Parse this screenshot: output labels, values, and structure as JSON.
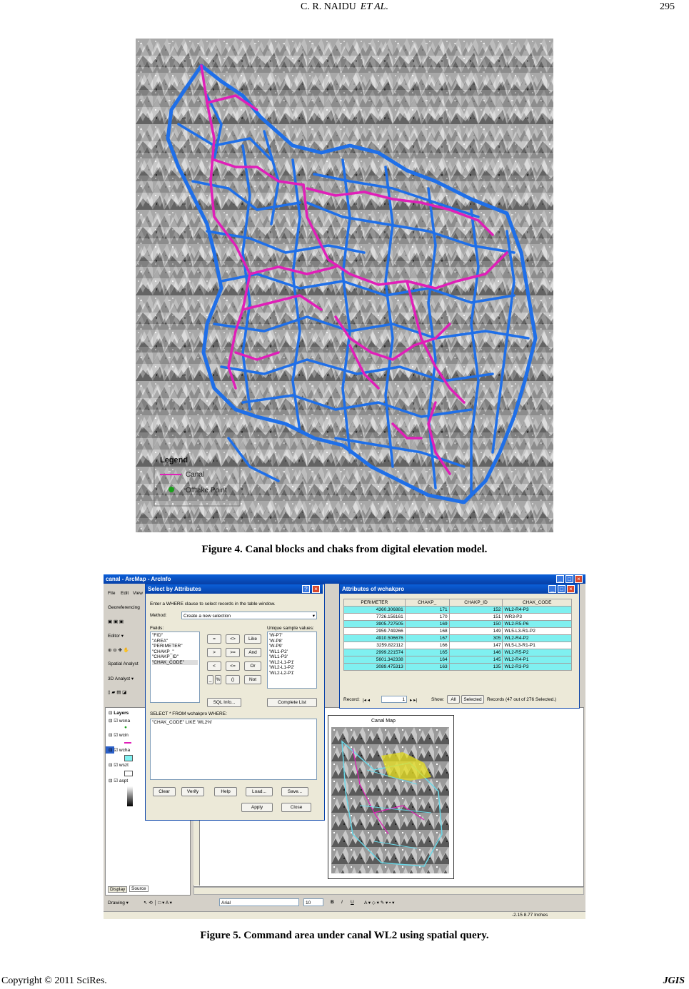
{
  "header": {
    "authors": "C. R. NAIDU",
    "etal": "ET AL.",
    "page_number": "295"
  },
  "figure4": {
    "caption": "Figure 4. Canal blocks and chaks from digital elevation model.",
    "legend_title": "Legend",
    "legend_items": [
      "Canal",
      "Offtake Point"
    ],
    "colors": {
      "canal": "#e01fb8",
      "block_boundary": "#1f6fe8",
      "offtake": "#1aa01a"
    }
  },
  "figure5": {
    "caption": "Figure 5. Command area under canal WL2 using spatial query.",
    "app_title": "canal - ArcMap - ArcInfo",
    "menu": [
      "File",
      "Edit",
      "View"
    ],
    "toolbar_left": [
      "Georeferencing",
      "Editor ▾",
      "Spatial Analyst",
      "3D Analyst ▾"
    ],
    "toc_title": "Layers",
    "toc_tabs": [
      "Display",
      "Source"
    ],
    "toc_layers": [
      "wcna",
      "wcin",
      "wcha",
      "wszt",
      "aspt"
    ],
    "select_dialog": {
      "title": "Select by Attributes",
      "instruction": "Enter a WHERE clause to select records in the table window.",
      "method_label": "Method:",
      "method_value": "Create a new selection",
      "fields_label": "Fields:",
      "fields": [
        "\"FID\"",
        "\"AREA\"",
        "\"PERIMETER\"",
        "\"CHAKP_\"",
        "\"CHAKP_ID\"",
        "\"CHAK_CODE\""
      ],
      "unique_label": "Unique sample values:",
      "unique_values": [
        "'W-P7'",
        "'W-P8'",
        "'W-P9'",
        "'WL1-P2'",
        "'WL1-P3'",
        "'WL2-L1-P1'",
        "'WL2-L1-P2'",
        "'WL2-L2-P1'"
      ],
      "operators": [
        "=",
        "<>",
        "Like",
        ">",
        ">=",
        "And",
        "<",
        "<=",
        "Or",
        "_",
        "%",
        "()",
        "Not"
      ],
      "sql_info": "SQL Info...",
      "complete_list": "Complete List",
      "select_from": "SELECT * FROM wchakpro WHERE:",
      "query": "\"CHAK_CODE\" LIKE 'WL2%'",
      "buttons": [
        "Clear",
        "Verify",
        "Help",
        "Load...",
        "Save..."
      ],
      "apply": "Apply",
      "close": "Close"
    },
    "attributes": {
      "title": "Attributes of wchakpro",
      "columns": [
        "PERIMETER",
        "CHAKP_",
        "CHAKP_ID",
        "CHAK_CODE"
      ],
      "rows": [
        [
          "4360.306881",
          "171",
          "152",
          "WL2-R4-P3",
          "sel"
        ],
        [
          "7726.156161",
          "170",
          "151",
          "WR3-P3",
          "nosel"
        ],
        [
          "3905.727505",
          "169",
          "150",
          "WL2-R5-P6",
          "sel"
        ],
        [
          "2959.749266",
          "168",
          "149",
          "WL5-L3-R1-P2",
          "nosel"
        ],
        [
          "4910.506676",
          "167",
          "305",
          "WL2-R4-P2",
          "sel"
        ],
        [
          "3259.822112",
          "166",
          "147",
          "WL5-L3-R1-P1",
          "nosel"
        ],
        [
          "2999.221574",
          "165",
          "146",
          "WL2-R5-P2",
          "sel"
        ],
        [
          "5601.342338",
          "164",
          "145",
          "WL2-R4-P1",
          "sel"
        ],
        [
          "3089.475313",
          "163",
          "135",
          "WL2-R3-P3",
          "sel"
        ]
      ],
      "record_label": "Record:",
      "record_value": "1",
      "show_label": "Show:",
      "show_all": "All",
      "show_selected": "Selected",
      "records_info": "Records (47 out of 276 Selected.)"
    },
    "map_title": "Canal Map",
    "drawing_toolbar": {
      "drawing": "Drawing ▾",
      "font": "Arial",
      "size": "10",
      "bold": "B",
      "italic": "I",
      "underline": "U",
      "text_tool": "A"
    },
    "status_coords": "-2.15  8.77 Inches"
  },
  "footer": {
    "copyright": "Copyright © 2011 SciRes.",
    "journal": "JGIS"
  }
}
